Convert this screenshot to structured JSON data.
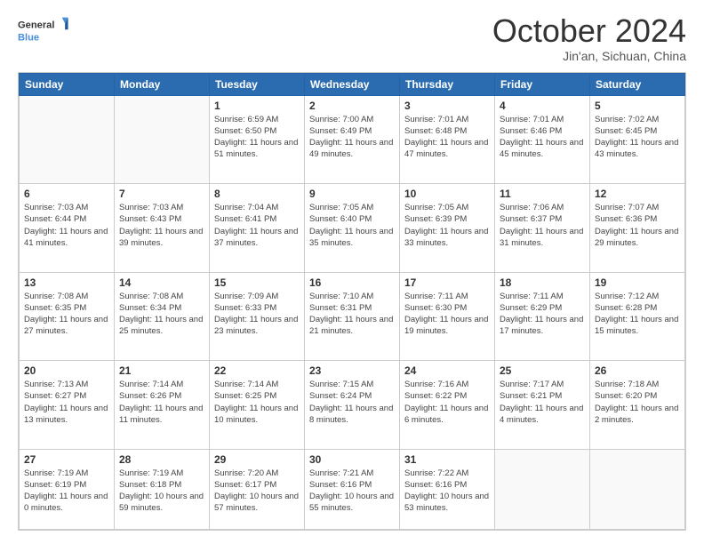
{
  "header": {
    "logo_general": "General",
    "logo_blue": "Blue",
    "month": "October 2024",
    "location": "Jin'an, Sichuan, China"
  },
  "weekdays": [
    "Sunday",
    "Monday",
    "Tuesday",
    "Wednesday",
    "Thursday",
    "Friday",
    "Saturday"
  ],
  "weeks": [
    [
      {
        "day": "",
        "info": ""
      },
      {
        "day": "",
        "info": ""
      },
      {
        "day": "1",
        "info": "Sunrise: 6:59 AM\nSunset: 6:50 PM\nDaylight: 11 hours and 51 minutes."
      },
      {
        "day": "2",
        "info": "Sunrise: 7:00 AM\nSunset: 6:49 PM\nDaylight: 11 hours and 49 minutes."
      },
      {
        "day": "3",
        "info": "Sunrise: 7:01 AM\nSunset: 6:48 PM\nDaylight: 11 hours and 47 minutes."
      },
      {
        "day": "4",
        "info": "Sunrise: 7:01 AM\nSunset: 6:46 PM\nDaylight: 11 hours and 45 minutes."
      },
      {
        "day": "5",
        "info": "Sunrise: 7:02 AM\nSunset: 6:45 PM\nDaylight: 11 hours and 43 minutes."
      }
    ],
    [
      {
        "day": "6",
        "info": "Sunrise: 7:03 AM\nSunset: 6:44 PM\nDaylight: 11 hours and 41 minutes."
      },
      {
        "day": "7",
        "info": "Sunrise: 7:03 AM\nSunset: 6:43 PM\nDaylight: 11 hours and 39 minutes."
      },
      {
        "day": "8",
        "info": "Sunrise: 7:04 AM\nSunset: 6:41 PM\nDaylight: 11 hours and 37 minutes."
      },
      {
        "day": "9",
        "info": "Sunrise: 7:05 AM\nSunset: 6:40 PM\nDaylight: 11 hours and 35 minutes."
      },
      {
        "day": "10",
        "info": "Sunrise: 7:05 AM\nSunset: 6:39 PM\nDaylight: 11 hours and 33 minutes."
      },
      {
        "day": "11",
        "info": "Sunrise: 7:06 AM\nSunset: 6:37 PM\nDaylight: 11 hours and 31 minutes."
      },
      {
        "day": "12",
        "info": "Sunrise: 7:07 AM\nSunset: 6:36 PM\nDaylight: 11 hours and 29 minutes."
      }
    ],
    [
      {
        "day": "13",
        "info": "Sunrise: 7:08 AM\nSunset: 6:35 PM\nDaylight: 11 hours and 27 minutes."
      },
      {
        "day": "14",
        "info": "Sunrise: 7:08 AM\nSunset: 6:34 PM\nDaylight: 11 hours and 25 minutes."
      },
      {
        "day": "15",
        "info": "Sunrise: 7:09 AM\nSunset: 6:33 PM\nDaylight: 11 hours and 23 minutes."
      },
      {
        "day": "16",
        "info": "Sunrise: 7:10 AM\nSunset: 6:31 PM\nDaylight: 11 hours and 21 minutes."
      },
      {
        "day": "17",
        "info": "Sunrise: 7:11 AM\nSunset: 6:30 PM\nDaylight: 11 hours and 19 minutes."
      },
      {
        "day": "18",
        "info": "Sunrise: 7:11 AM\nSunset: 6:29 PM\nDaylight: 11 hours and 17 minutes."
      },
      {
        "day": "19",
        "info": "Sunrise: 7:12 AM\nSunset: 6:28 PM\nDaylight: 11 hours and 15 minutes."
      }
    ],
    [
      {
        "day": "20",
        "info": "Sunrise: 7:13 AM\nSunset: 6:27 PM\nDaylight: 11 hours and 13 minutes."
      },
      {
        "day": "21",
        "info": "Sunrise: 7:14 AM\nSunset: 6:26 PM\nDaylight: 11 hours and 11 minutes."
      },
      {
        "day": "22",
        "info": "Sunrise: 7:14 AM\nSunset: 6:25 PM\nDaylight: 11 hours and 10 minutes."
      },
      {
        "day": "23",
        "info": "Sunrise: 7:15 AM\nSunset: 6:24 PM\nDaylight: 11 hours and 8 minutes."
      },
      {
        "day": "24",
        "info": "Sunrise: 7:16 AM\nSunset: 6:22 PM\nDaylight: 11 hours and 6 minutes."
      },
      {
        "day": "25",
        "info": "Sunrise: 7:17 AM\nSunset: 6:21 PM\nDaylight: 11 hours and 4 minutes."
      },
      {
        "day": "26",
        "info": "Sunrise: 7:18 AM\nSunset: 6:20 PM\nDaylight: 11 hours and 2 minutes."
      }
    ],
    [
      {
        "day": "27",
        "info": "Sunrise: 7:19 AM\nSunset: 6:19 PM\nDaylight: 11 hours and 0 minutes."
      },
      {
        "day": "28",
        "info": "Sunrise: 7:19 AM\nSunset: 6:18 PM\nDaylight: 10 hours and 59 minutes."
      },
      {
        "day": "29",
        "info": "Sunrise: 7:20 AM\nSunset: 6:17 PM\nDaylight: 10 hours and 57 minutes."
      },
      {
        "day": "30",
        "info": "Sunrise: 7:21 AM\nSunset: 6:16 PM\nDaylight: 10 hours and 55 minutes."
      },
      {
        "day": "31",
        "info": "Sunrise: 7:22 AM\nSunset: 6:16 PM\nDaylight: 10 hours and 53 minutes."
      },
      {
        "day": "",
        "info": ""
      },
      {
        "day": "",
        "info": ""
      }
    ]
  ]
}
